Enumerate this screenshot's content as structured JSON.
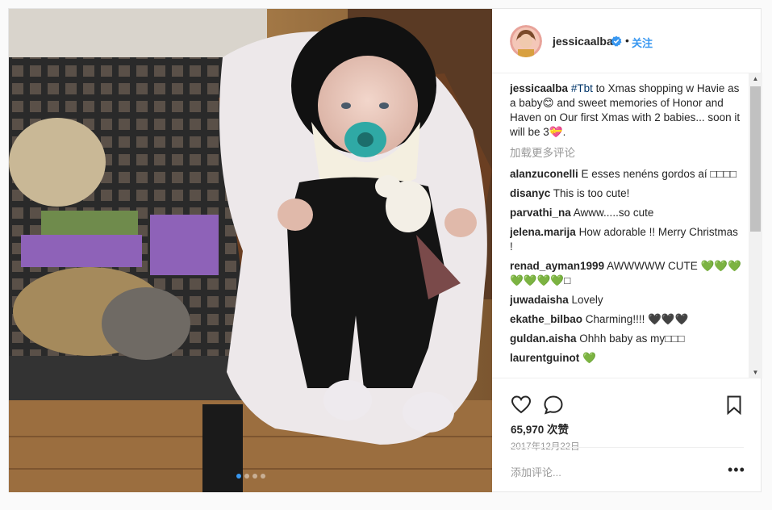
{
  "header": {
    "username": "jessicaalba",
    "separator": "•",
    "follow_label": "关注"
  },
  "caption": {
    "username": "jessicaalba",
    "hashtag": "#Tbt",
    "text": " to Xmas shopping w Havie as a baby😊 and sweet memories of Honor and Haven on Our first Xmas with 2 babies... soon it will be 3💝."
  },
  "load_more_label": "加载更多评论",
  "comments": [
    {
      "user": "alanzuconelli",
      "text": "E esses nenéns gordos aí □□□□"
    },
    {
      "user": "disanyc",
      "text": "This is too cute!"
    },
    {
      "user": "parvathi_na",
      "text": "Awww.....so cute"
    },
    {
      "user": "jelena.marija",
      "text": "How adorable !! Merry Christmas !"
    },
    {
      "user": "renad_ayman1999",
      "text": "AWWWWW CUTE 💚💚💚💚💚💚💚□"
    },
    {
      "user": "juwadaisha",
      "text": "Lovely"
    },
    {
      "user": "ekathe_bilbao",
      "text": "Charming!!!! 🖤🖤🖤"
    },
    {
      "user": "guldan.aisha",
      "text": "Ohhh baby as my□□□"
    },
    {
      "user": "laurentguinot",
      "text": "💚"
    }
  ],
  "actions": {
    "like_icon": "heart-icon",
    "comment_icon": "speech-bubble-icon",
    "save_icon": "bookmark-icon"
  },
  "likes_text": "65,970 次赞",
  "date_text": "2017年12月22日",
  "add_comment_placeholder": "添加评论...",
  "more_label": "•••",
  "carousel": {
    "count": 4,
    "active": 1
  },
  "colors": {
    "accent": "#3897f0",
    "verified": "#3897f0"
  }
}
